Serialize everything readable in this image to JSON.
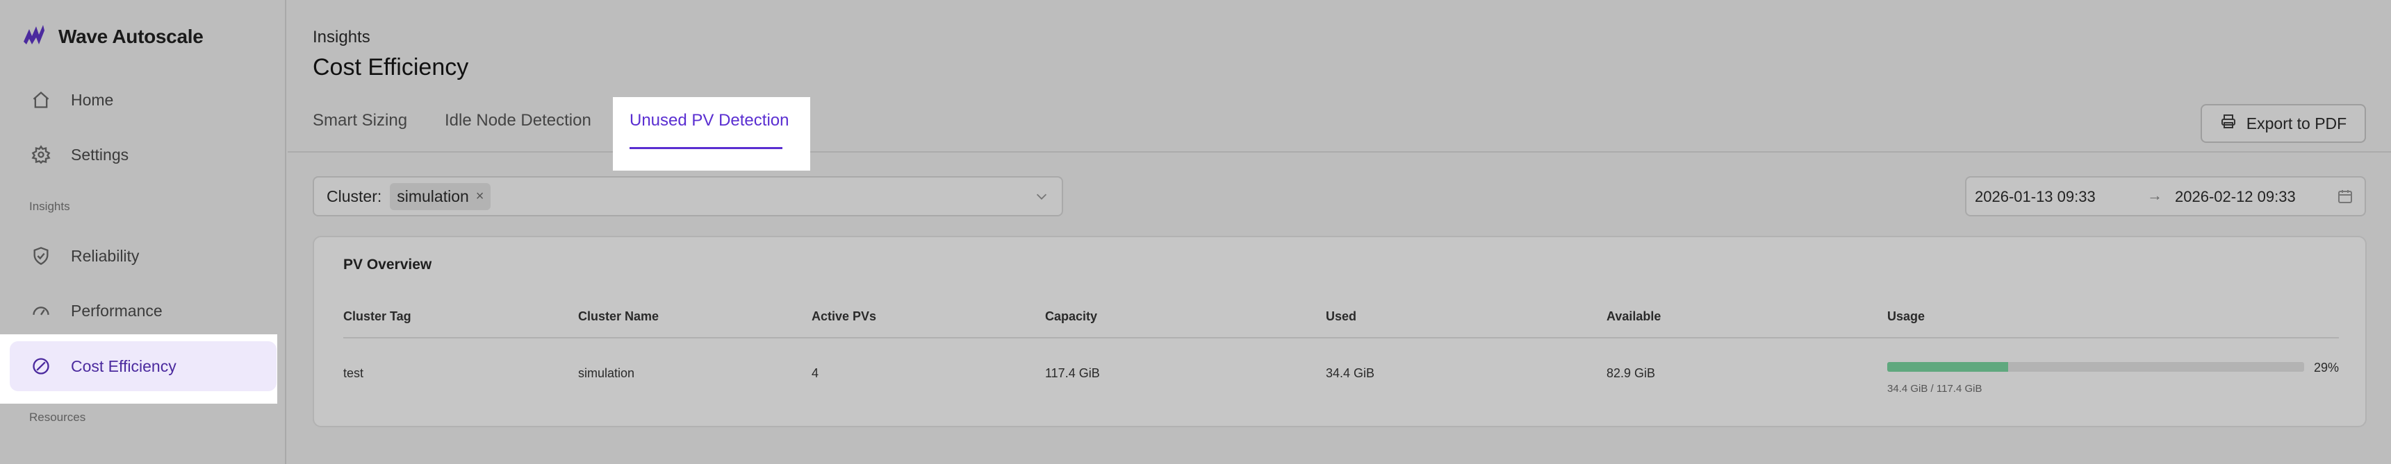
{
  "app": {
    "name": "Wave Autoscale"
  },
  "sidebar": {
    "items": [
      {
        "label": "Home",
        "icon": "home-icon"
      },
      {
        "label": "Settings",
        "icon": "gear-icon"
      }
    ],
    "insights_label": "Insights",
    "insights_items": [
      {
        "label": "Reliability",
        "icon": "shield-check-icon"
      },
      {
        "label": "Performance",
        "icon": "gauge-icon"
      },
      {
        "label": "Cost Efficiency",
        "icon": "slash-circle-icon",
        "active": true
      }
    ],
    "resources_label": "Resources"
  },
  "header": {
    "breadcrumb": "Insights",
    "title": "Cost Efficiency",
    "tabs": [
      {
        "label": "Smart Sizing"
      },
      {
        "label": "Idle Node Detection"
      },
      {
        "label": "Unused PV Detection",
        "active": true
      }
    ],
    "export_label": "Export to PDF"
  },
  "filters": {
    "cluster_label": "Cluster:",
    "cluster_chip": "simulation",
    "chip_remove": "×",
    "date_start": "2026-01-13 09:33",
    "date_arrow": "→",
    "date_end": "2026-02-12 09:33"
  },
  "pv_overview": {
    "title": "PV Overview",
    "columns": [
      "Cluster Tag",
      "Cluster Name",
      "Active PVs",
      "Capacity",
      "Used",
      "Available",
      "Usage"
    ],
    "rows": [
      {
        "cluster_tag": "test",
        "cluster_name": "simulation",
        "active_pvs": "4",
        "capacity": "117.4 GiB",
        "used": "34.4 GiB",
        "available": "82.9 GiB",
        "usage_pct": "29%",
        "usage_fraction": 0.29,
        "usage_detail": "34.4 GiB / 117.4 GiB"
      }
    ]
  },
  "colors": {
    "accent": "#5a2ed1",
    "usage_bar": "#5fa87e",
    "active_nav_bg": "#eee9fb"
  }
}
